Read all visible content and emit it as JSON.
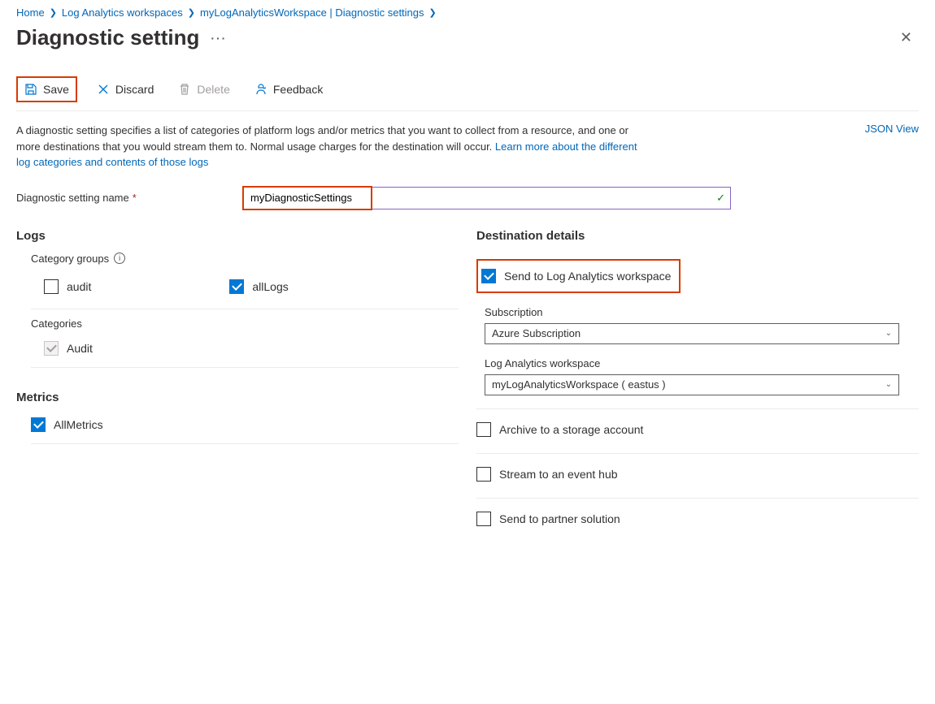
{
  "breadcrumb": {
    "items": [
      "Home",
      "Log Analytics workspaces",
      "myLogAnalyticsWorkspace | Diagnostic settings"
    ]
  },
  "page": {
    "title": "Diagnostic setting"
  },
  "toolbar": {
    "save": "Save",
    "discard": "Discard",
    "delete": "Delete",
    "feedback": "Feedback"
  },
  "description": {
    "text": "A diagnostic setting specifies a list of categories of platform logs and/or metrics that you want to collect from a resource, and one or more destinations that you would stream them to. Normal usage charges for the destination will occur. ",
    "link": "Learn more about the different log categories and contents of those logs",
    "jsonView": "JSON View"
  },
  "nameField": {
    "label": "Diagnostic setting name",
    "value": "myDiagnosticSettings"
  },
  "logs": {
    "heading": "Logs",
    "categoryGroupsLabel": "Category groups",
    "groups": {
      "audit": "audit",
      "allLogs": "allLogs"
    },
    "categoriesLabel": "Categories",
    "categories": {
      "audit": "Audit"
    }
  },
  "metrics": {
    "heading": "Metrics",
    "allMetrics": "AllMetrics"
  },
  "destination": {
    "heading": "Destination details",
    "sendToLaw": "Send to Log Analytics workspace",
    "subscriptionLabel": "Subscription",
    "subscriptionValue": "Azure Subscription",
    "workspaceLabel": "Log Analytics workspace",
    "workspaceValue": "myLogAnalyticsWorkspace ( eastus )",
    "archiveStorage": "Archive to a storage account",
    "streamEventHub": "Stream to an event hub",
    "sendPartner": "Send to partner solution"
  }
}
